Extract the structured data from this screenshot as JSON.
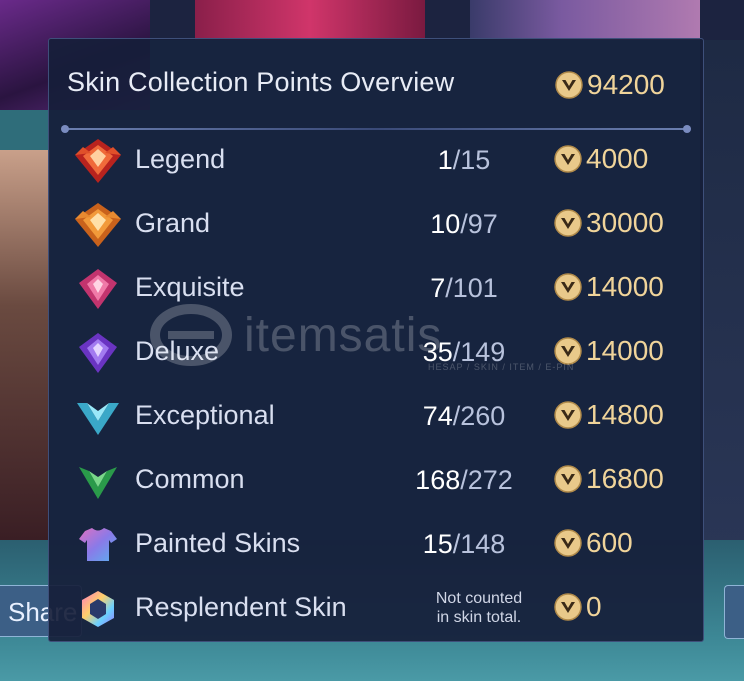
{
  "panel": {
    "title": "Skin Collection Points Overview",
    "total_points": "94200"
  },
  "rows": [
    {
      "name": "Legend",
      "owned": "1",
      "total": "15",
      "points": "4000",
      "icon": "legend-tier-icon"
    },
    {
      "name": "Grand",
      "owned": "10",
      "total": "97",
      "points": "30000",
      "icon": "grand-tier-icon"
    },
    {
      "name": "Exquisite",
      "owned": "7",
      "total": "101",
      "points": "14000",
      "icon": "exquisite-tier-icon"
    },
    {
      "name": "Deluxe",
      "owned": "35",
      "total": "149",
      "points": "14000",
      "icon": "deluxe-tier-icon"
    },
    {
      "name": "Exceptional",
      "owned": "74",
      "total": "260",
      "points": "14800",
      "icon": "exceptional-tier-icon"
    },
    {
      "name": "Common",
      "owned": "168",
      "total": "272",
      "points": "16800",
      "icon": "common-tier-icon"
    },
    {
      "name": "Painted Skins",
      "owned": "15",
      "total": "148",
      "points": "600",
      "icon": "painted-shirt-icon"
    }
  ],
  "resplendent": {
    "name": "Resplendent Skin",
    "note_line1": "Not counted",
    "note_line2": "in skin total.",
    "points": "0",
    "icon": "resplendent-gem-icon"
  },
  "buttons": {
    "share_label": "Share"
  },
  "watermark": {
    "text": "itemsatis",
    "subtext": "HESAP / SKIN / ITEM / E-PIN"
  },
  "colors": {
    "panel_bg": "#161e3a",
    "points_gold": "#f0d49a",
    "text_light": "#d9dff0"
  }
}
